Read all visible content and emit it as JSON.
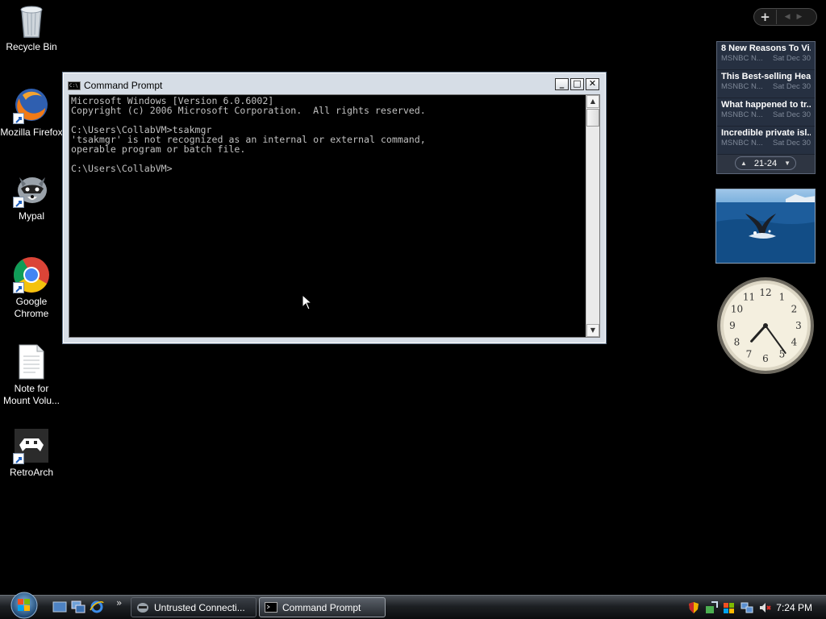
{
  "desktop": {
    "icons": [
      {
        "label": "Recycle Bin",
        "icon": "recycle-bin-icon"
      },
      {
        "label": "Mozilla Firefox",
        "icon": "firefox-icon"
      },
      {
        "label": "Mypal",
        "icon": "mypal-icon"
      },
      {
        "label": "Google Chrome",
        "icon": "chrome-icon"
      },
      {
        "label": "Note for Mount Volu...",
        "icon": "text-file-icon"
      },
      {
        "label": "RetroArch",
        "icon": "retroarch-icon"
      }
    ]
  },
  "cmd_window": {
    "title": "Command Prompt",
    "lines": [
      "Microsoft Windows [Version 6.0.6002]",
      "Copyright (c) 2006 Microsoft Corporation.  All rights reserved.",
      "",
      "C:\\Users\\CollabVM>tsakmgr",
      "'tsakmgr' is not recognized as an internal or external command,",
      "operable program or batch file.",
      "",
      "C:\\Users\\CollabVM>"
    ],
    "controls": {
      "minimize": "_",
      "maximize": "□",
      "close": "✕"
    }
  },
  "gadgets": {
    "control_bar": {
      "add_label": "+"
    },
    "news": {
      "items": [
        {
          "headline": "8 New Reasons To Vi...",
          "source": "MSNBC N...",
          "date": "Sat Dec 30"
        },
        {
          "headline": "This Best-selling Hea...",
          "source": "MSNBC N...",
          "date": "Sat Dec 30"
        },
        {
          "headline": "What happened to tr...",
          "source": "MSNBC N...",
          "date": "Sat Dec 30"
        },
        {
          "headline": "Incredible private isl...",
          "source": "MSNBC N...",
          "date": "Sat Dec 30"
        }
      ],
      "range": "21-24"
    },
    "clock": {
      "hour": 7,
      "minute": 24
    }
  },
  "taskbar": {
    "buttons": [
      {
        "label": "Untrusted Connecti...",
        "active": false
      },
      {
        "label": "Command Prompt",
        "active": true
      }
    ],
    "time": "7:24 PM"
  },
  "colors": {
    "desktop_bg": "#000000",
    "console_text": "#c0c0c0",
    "taskbar": "#1d2024"
  }
}
